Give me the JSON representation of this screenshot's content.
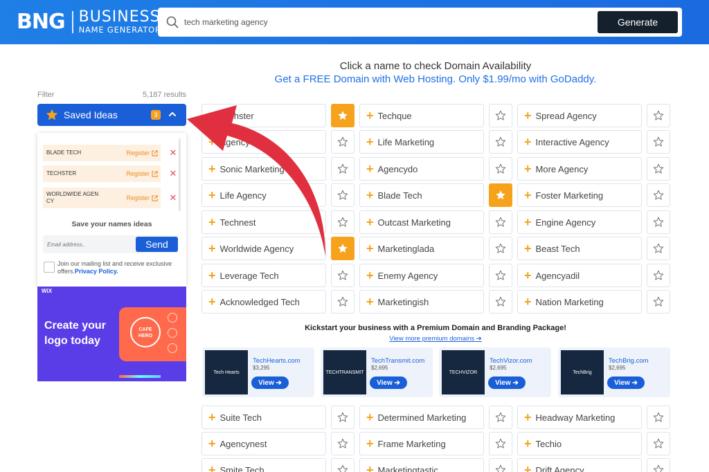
{
  "header": {
    "logo_mark": "BNG",
    "logo_line1": "BUSINESS",
    "logo_line2": "NAME GENERATOR",
    "search_value": "tech marketing agency",
    "generate_label": "Generate"
  },
  "intro": {
    "line1": "Click a name to check Domain Availability",
    "line2": "Get a FREE Domain with Web Hosting. Only $1.99/mo with GoDaddy."
  },
  "sidebar": {
    "filter_label": "Filter",
    "results": "5,187 results",
    "saved_label": "Saved Ideas",
    "saved_count": "3",
    "saved_items": [
      {
        "name": "BLADE TECH",
        "action": "Register"
      },
      {
        "name": "TECHSTER",
        "action": "Register"
      },
      {
        "name": "WORLDWIDE AGEN CY",
        "action": "Register"
      }
    ],
    "save_title": "Save your names ideas",
    "email_placeholder": "Email address..",
    "send_label": "Send",
    "mailing_text": "Join our mailing list and receive exclusive offers.",
    "privacy_label": "Privacy Policy."
  },
  "ad": {
    "brand": "WiX",
    "headline": "Create your logo today",
    "logo_text": "CAFE HERO"
  },
  "names": [
    {
      "label": "Techster",
      "starred": true
    },
    {
      "label": "Techque",
      "starred": false
    },
    {
      "label": "Spread Agency",
      "starred": false
    },
    {
      "label": "Agency",
      "starred": false
    },
    {
      "label": "Life Marketing",
      "starred": false
    },
    {
      "label": "Interactive Agency",
      "starred": false
    },
    {
      "label": "Sonic Marketing",
      "starred": false
    },
    {
      "label": "Agencydo",
      "starred": false
    },
    {
      "label": "More Agency",
      "starred": false
    },
    {
      "label": "Life Agency",
      "starred": false
    },
    {
      "label": "Blade Tech",
      "starred": true
    },
    {
      "label": "Foster Marketing",
      "starred": false
    },
    {
      "label": "Technest",
      "starred": false
    },
    {
      "label": "Outcast Marketing",
      "starred": false
    },
    {
      "label": "Engine Agency",
      "starred": false
    },
    {
      "label": "Worldwide Agency",
      "starred": true
    },
    {
      "label": "Marketinglada",
      "starred": false
    },
    {
      "label": "Beast Tech",
      "starred": false
    },
    {
      "label": "Leverage Tech",
      "starred": false
    },
    {
      "label": "Enemy Agency",
      "starred": false
    },
    {
      "label": "Agencyadil",
      "starred": false
    },
    {
      "label": "Acknowledged Tech",
      "starred": false
    },
    {
      "label": "Marketingish",
      "starred": false
    },
    {
      "label": "Nation Marketing",
      "starred": false
    }
  ],
  "premium": {
    "title": "Kickstart your business with a Premium Domain and Branding Package!",
    "link": "View more premium domains",
    "cards": [
      {
        "domain": "TechHearts.com",
        "price": "$3,295",
        "view": "View",
        "logo": "Tech Hearts"
      },
      {
        "domain": "TechTransmit.com",
        "price": "$2,695",
        "view": "View",
        "logo": "TECHTRANSMIT"
      },
      {
        "domain": "TechVizor.com",
        "price": "$2,695",
        "view": "View",
        "logo": "TECHVIZOR"
      },
      {
        "domain": "TechBrig.com",
        "price": "$2,695",
        "view": "View",
        "logo": "TechBrig"
      }
    ]
  },
  "names_more": [
    {
      "label": "Suite Tech",
      "starred": false
    },
    {
      "label": "Determined Marketing",
      "starred": false
    },
    {
      "label": "Headway Marketing",
      "starred": false
    },
    {
      "label": "Agencynest",
      "starred": false
    },
    {
      "label": "Frame Marketing",
      "starred": false
    },
    {
      "label": "Techio",
      "starred": false
    },
    {
      "label": "Smite Tech",
      "starred": false
    },
    {
      "label": "Marketingtastic",
      "starred": false
    },
    {
      "label": "Drift Agency",
      "starred": false
    }
  ],
  "colors": {
    "brand_blue": "#1a5fd8",
    "accent_orange": "#f7a21c",
    "arrow_red": "#e0303f"
  }
}
